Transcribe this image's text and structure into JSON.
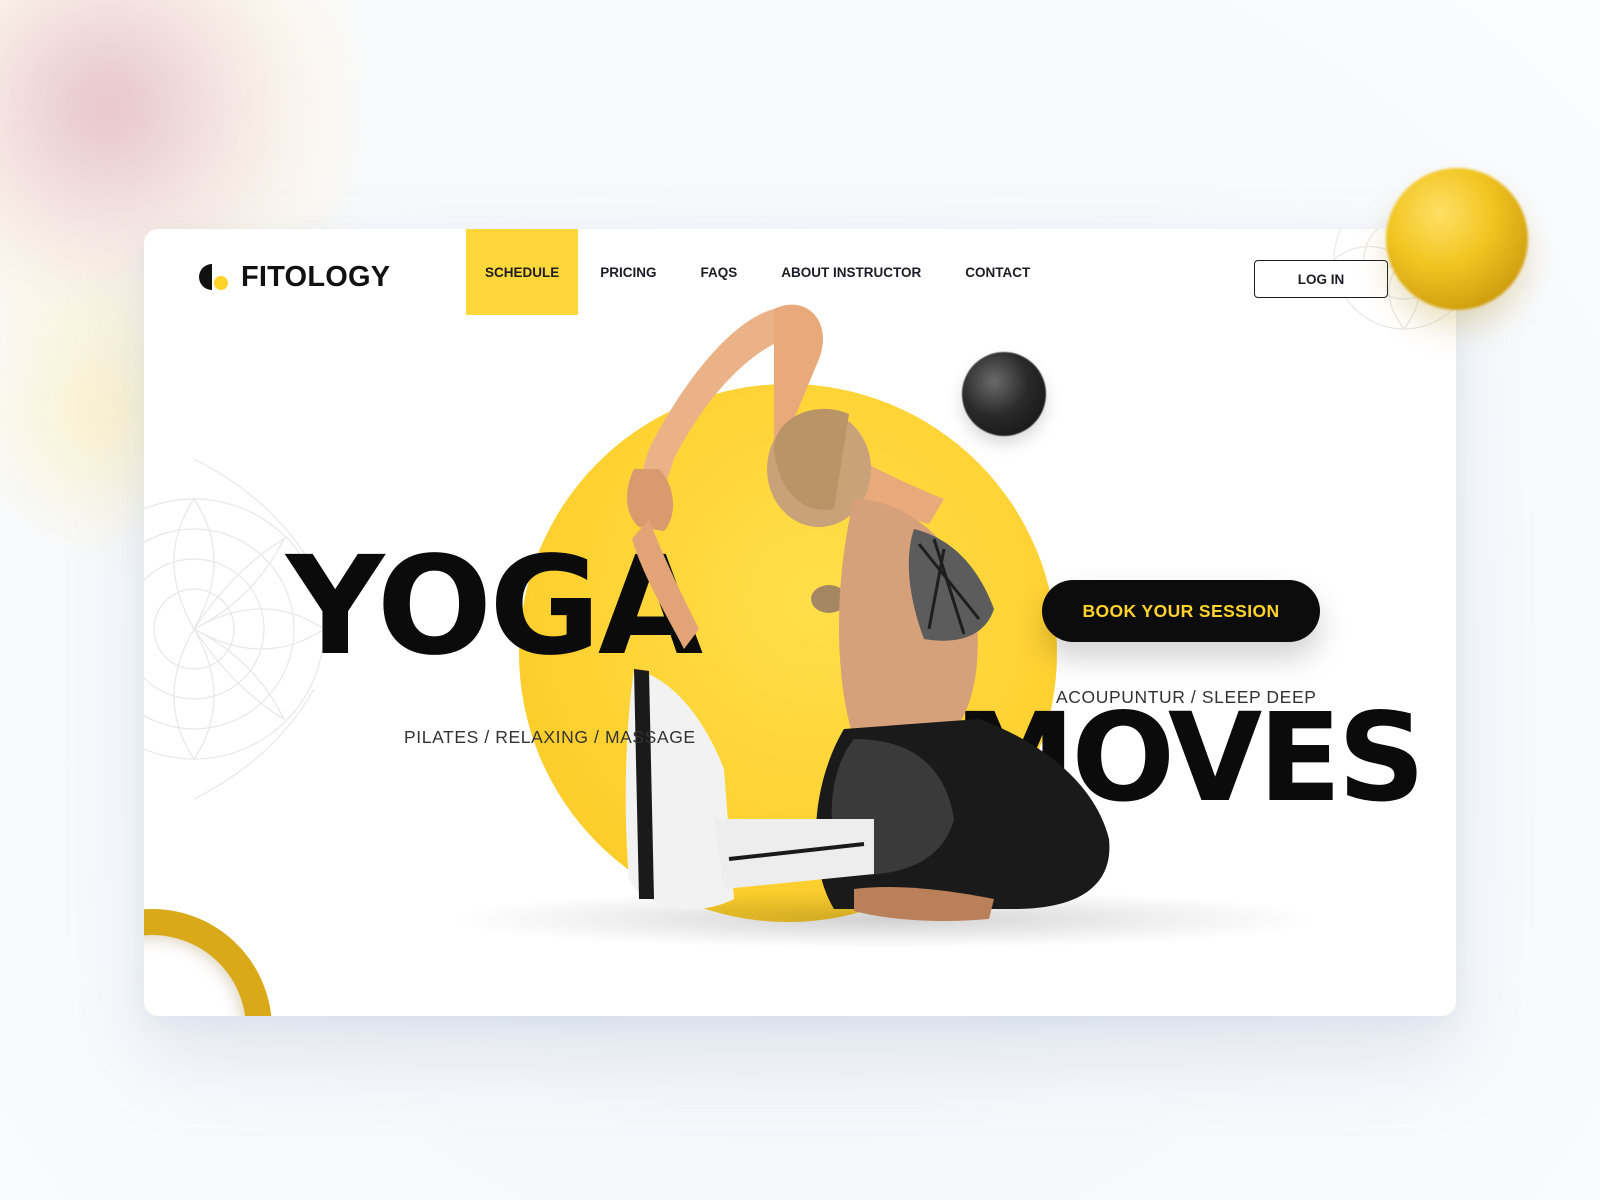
{
  "brand": {
    "name": "FITOLOGY"
  },
  "nav": {
    "items": [
      {
        "label": "SCHEDULE",
        "active": true
      },
      {
        "label": "PRICING",
        "active": false
      },
      {
        "label": "FAQS",
        "active": false
      },
      {
        "label": "ABOUT INSTRUCTOR",
        "active": false
      },
      {
        "label": "CONTACT",
        "active": false
      }
    ],
    "login_label": "LOG IN"
  },
  "hero": {
    "title_1": "YOGA",
    "title_2": "MOVES",
    "subtitle_left": "PILATES / RELAXING / MASSAGE",
    "subtitle_right": "ACOUPUNTUR / SLEEP DEEP",
    "cta_label": "BOOK YOUR SESSION"
  },
  "colors": {
    "accent": "#ffd32a",
    "dark": "#0c0c0c",
    "text": "#1c1c24"
  },
  "icons": {
    "logo": "half-circle-dot-logo-icon"
  }
}
